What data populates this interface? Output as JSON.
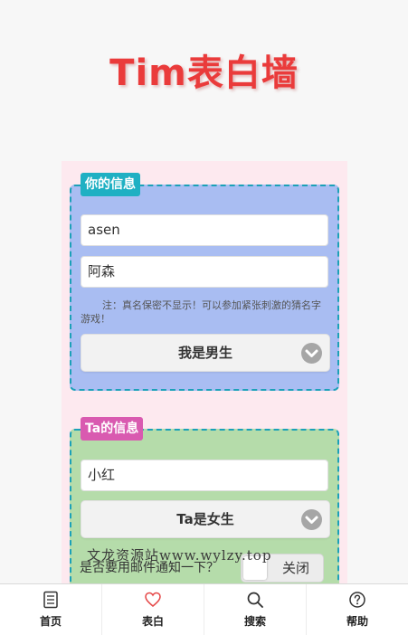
{
  "header": {
    "title": "Tim表白墙"
  },
  "mine": {
    "tag": "你的信息",
    "nickname": "asen",
    "realname": "阿森",
    "note": "注：真名保密不显示！可以参加紧张刺激的猜名字游戏！",
    "gender": "我是男生"
  },
  "theirs": {
    "tag": "Ta的信息",
    "name": "小红",
    "gender": "Ta是女生"
  },
  "notify": {
    "label": "是否要用邮件通知一下？",
    "toggle_label": "关闭"
  },
  "watermark": "文龙资源站www.wylzy.top",
  "tabs": [
    {
      "label": "首页",
      "icon": "document-icon"
    },
    {
      "label": "表白",
      "icon": "heart-icon"
    },
    {
      "label": "搜索",
      "icon": "search-icon"
    },
    {
      "label": "帮助",
      "icon": "help-icon"
    }
  ],
  "colors": {
    "title": "#ea3b3b",
    "mine_card": "#a9bdf2",
    "theirs_card": "#b5dcaa",
    "tag_blue": "#1fb0c3",
    "tag_pink": "#d95ab0",
    "heart": "#e54848"
  }
}
